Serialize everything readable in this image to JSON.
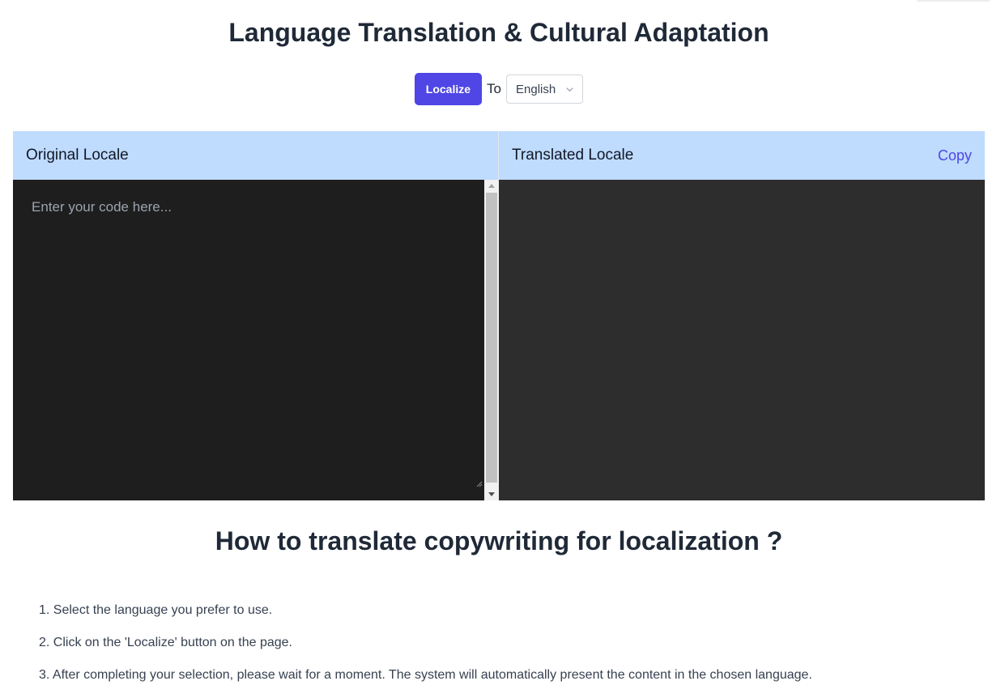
{
  "page": {
    "title": "Language Translation & Cultural Adaptation"
  },
  "controls": {
    "localize_label": "Localize",
    "to_label": "To",
    "language_selected": "English",
    "accent_color": "#4f46e5"
  },
  "original_panel": {
    "title": "Original Locale",
    "placeholder": "Enter your code here...",
    "value": ""
  },
  "translated_panel": {
    "title": "Translated Locale",
    "copy_label": "Copy",
    "value": ""
  },
  "howto": {
    "heading": "How to translate copywriting for localization ?",
    "steps": [
      "1. Select the language you prefer to use.",
      "2. Click on the 'Localize' button on the page.",
      "3. After completing your selection, please wait for a moment. The system will automatically present the content in the chosen language."
    ]
  },
  "colors": {
    "header_bg": "#bfdbfe",
    "editor_left_bg": "#1e1e1e",
    "editor_right_bg": "#2d2d2d"
  }
}
